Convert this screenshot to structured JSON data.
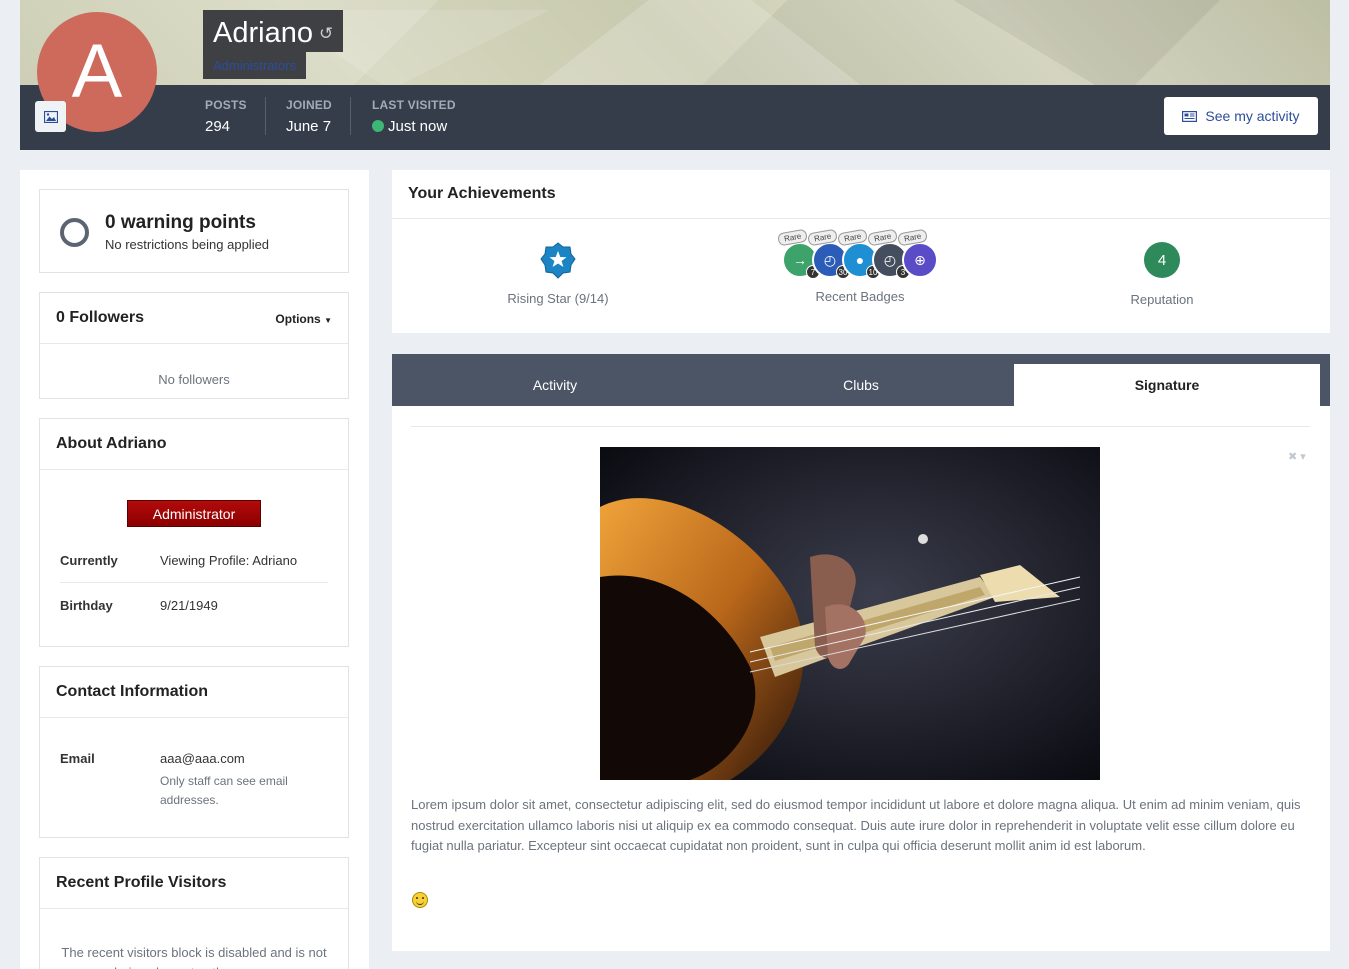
{
  "profile": {
    "avatar_letter": "A",
    "name": "Adriano",
    "group": "Administrators",
    "stats": [
      {
        "label": "POSTS",
        "value": "294"
      },
      {
        "label": "JOINED",
        "value": "June 7"
      },
      {
        "label": "LAST VISITED",
        "value": "Just now"
      }
    ],
    "activity_button": "See my activity"
  },
  "warnings": {
    "title": "0 warning points",
    "subtitle": "No restrictions being applied"
  },
  "followers": {
    "title": "0 Followers",
    "options": "Options",
    "empty": "No followers"
  },
  "about": {
    "title": "About Adriano",
    "role_tag": "Administrator",
    "fields": [
      {
        "key": "Currently",
        "value": "Viewing Profile: Adriano"
      },
      {
        "key": "Birthday",
        "value": "9/21/1949"
      }
    ]
  },
  "contact": {
    "title": "Contact Information",
    "email_label": "Email",
    "email_value": "aaa@aaa.com",
    "email_note": "Only staff can see email addresses."
  },
  "visitors": {
    "title": "Recent Profile Visitors",
    "message": "The recent visitors block is disabled and is not being shown to other users."
  },
  "achievements": {
    "title": "Your Achievements",
    "rank_label": "Rising Star (9/14)",
    "badges_label": "Recent Badges",
    "rare_label": "Rare",
    "badge_counts": [
      "7",
      "30",
      "10",
      "3",
      ""
    ],
    "reputation_value": "4",
    "reputation_label": "Reputation"
  },
  "tabs": {
    "items": [
      "Activity",
      "Clubs",
      "Signature"
    ],
    "active": "Signature"
  },
  "signature": {
    "text": "Lorem ipsum dolor sit amet, consectetur adipiscing elit, sed do eiusmod tempor incididunt ut labore et dolore magna aliqua. Ut enim ad minim veniam, quis nostrud exercitation ullamco laboris nisi ut aliquip ex ea commodo consequat. Duis aute irure dolor in reprehenderit in voluptate velit esse cillum dolore eu fugiat nulla pariatur. Excepteur sint occaecat cupidatat non proident, sunt in culpa qui officia deserunt mollit anim id est laborum."
  },
  "colors": {
    "header_bar": "#353d4a",
    "avatar": "#cd6a5c",
    "link": "#2c4d9c",
    "online": "#3eb776",
    "reputation": "#2e8a5b",
    "admin_tag": "#a00000"
  }
}
